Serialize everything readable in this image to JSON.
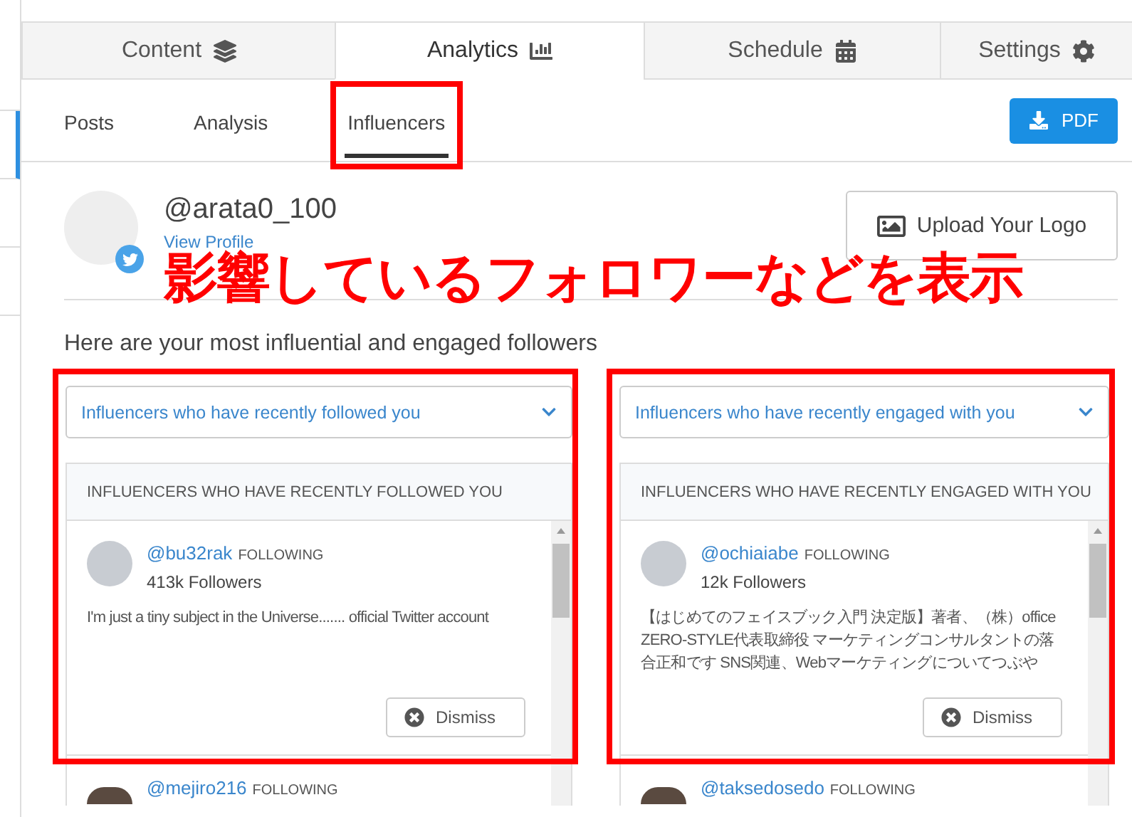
{
  "tabs": [
    {
      "label": "Content",
      "selected": false
    },
    {
      "label": "Analytics",
      "selected": true
    },
    {
      "label": "Schedule",
      "selected": false
    },
    {
      "label": "Settings",
      "selected": false
    }
  ],
  "subtabs": [
    {
      "label": "Posts",
      "selected": false,
      "highlighted": false
    },
    {
      "label": "Analysis",
      "selected": false,
      "highlighted": false
    },
    {
      "label": "Influencers",
      "selected": true,
      "highlighted": true
    }
  ],
  "pdf_button": "PDF",
  "profile": {
    "handle": "@arata0_100",
    "link": "View Profile"
  },
  "upload_button": "Upload Your Logo",
  "annotation": "影響しているフォロワーなどを表示",
  "intro": "Here are your most influential and engaged followers",
  "columns": [
    {
      "highlighted": true,
      "dropdown": "Influencers who have recently followed you",
      "header": "INFLUENCERS WHO HAVE RECENTLY FOLLOWED YOU",
      "items": [
        {
          "handle": "@bu32rak",
          "status": "FOLLOWING",
          "followers": "413k Followers",
          "bio": "I'm just a tiny subject in the Universe....... official Twitter account",
          "dismiss": "Dismiss"
        },
        {
          "handle": "@mejiro216",
          "status": "FOLLOWING"
        }
      ]
    },
    {
      "highlighted": true,
      "dropdown": "Influencers who have recently engaged with you",
      "header": "INFLUENCERS WHO HAVE RECENTLY ENGAGED WITH YOU",
      "items": [
        {
          "handle": "@ochiaiabe",
          "status": "FOLLOWING",
          "followers": "12k Followers",
          "bio": "【はじめてのフェイスブック入門 決定版】著者、（株）office ZERO-STYLE代表取締役 マーケティングコンサルタントの落合正和です SNS関連、Webマーケティングについてつぶや",
          "dismiss": "Dismiss"
        },
        {
          "handle": "@taksedosedo",
          "status": "FOLLOWING"
        }
      ]
    }
  ]
}
